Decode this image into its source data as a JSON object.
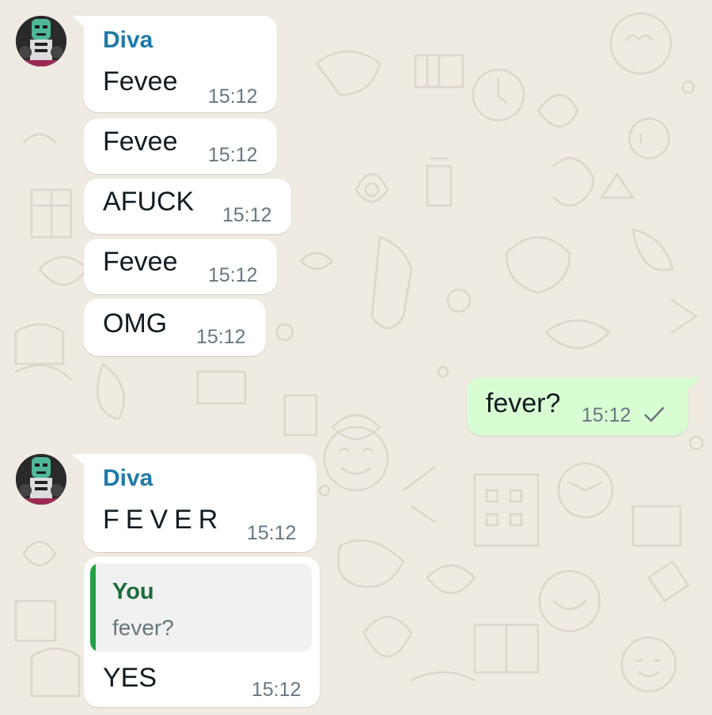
{
  "colors": {
    "background": "#efeae2",
    "incoming_bubble": "#ffffff",
    "outgoing_bubble": "#d9fdd3",
    "sender_name": "#1f7aa8",
    "quote_accent": "#25a244",
    "timestamp": "#667781"
  },
  "messages": [
    {
      "direction": "incoming",
      "sender": "Diva",
      "text": "Fevee",
      "time": "15:12"
    },
    {
      "direction": "incoming",
      "text": "Fevee",
      "time": "15:12"
    },
    {
      "direction": "incoming",
      "text": "AFUCK",
      "time": "15:12"
    },
    {
      "direction": "incoming",
      "text": "Fevee",
      "time": "15:12"
    },
    {
      "direction": "incoming",
      "text": "OMG",
      "time": "15:12"
    },
    {
      "direction": "outgoing",
      "text": "fever?",
      "time": "15:12",
      "status_icon": "single-check-icon"
    },
    {
      "direction": "incoming",
      "sender": "Diva",
      "text": "FEVER",
      "time": "15:12"
    },
    {
      "direction": "incoming",
      "quoted": {
        "author": "You",
        "text": "fever?"
      },
      "text": "YES",
      "time": "15:12"
    }
  ]
}
